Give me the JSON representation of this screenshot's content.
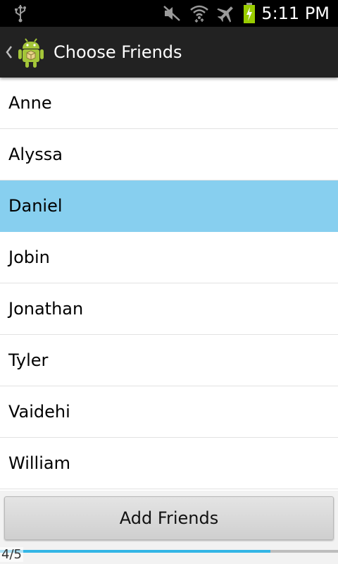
{
  "status_bar": {
    "time": "5:11 PM",
    "icons": [
      "usb-icon",
      "mute-icon",
      "wifi-icon",
      "airplane-mode-icon",
      "battery-charging-icon"
    ]
  },
  "action_bar": {
    "title": "Choose Friends",
    "up_icon": "chevron-left-icon",
    "app_icon": "android-icon"
  },
  "friends_list": {
    "items": [
      {
        "label": "Anne",
        "selected": false
      },
      {
        "label": "Alyssa",
        "selected": false
      },
      {
        "label": "Daniel",
        "selected": true
      },
      {
        "label": "Jobin",
        "selected": false
      },
      {
        "label": "Jonathan",
        "selected": false
      },
      {
        "label": "Tyler",
        "selected": false
      },
      {
        "label": "Vaidehi",
        "selected": false
      },
      {
        "label": "William",
        "selected": false
      }
    ]
  },
  "footer": {
    "add_button_label": "Add Friends",
    "page_indicator": "4/5",
    "progress_fraction": 0.8
  },
  "colors": {
    "selected_row": "#87cfef",
    "action_bar": "#222222",
    "status_bar": "#000000",
    "progress": "#33b5e5"
  }
}
